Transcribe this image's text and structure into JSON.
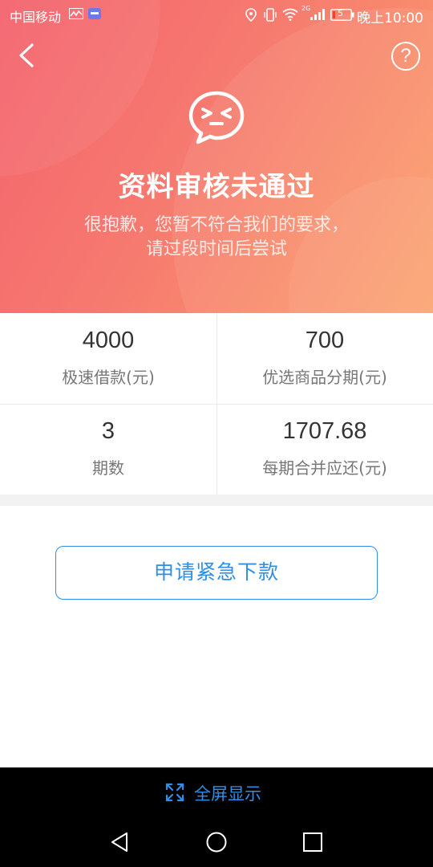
{
  "status_bar": {
    "carrier": "中国移动",
    "battery": "5",
    "network": "2G",
    "time": "晚上10:00"
  },
  "header": {
    "back_icon": "chevron-left-icon",
    "help_icon": "question-circle-icon",
    "help_glyph": "?",
    "status_icon": "dizzy-face-chat-bubble-icon",
    "title": "资料审核未通过",
    "description": "很抱歉，您暂不符合我们的要求，请过段时间后尝试"
  },
  "stats": [
    {
      "value": "4000",
      "label": "极速借款(元)"
    },
    {
      "value": "700",
      "label": "优选商品分期(元)"
    },
    {
      "value": "3",
      "label": "期数"
    },
    {
      "value": "1707.68",
      "label": "每期合并应还(元)"
    }
  ],
  "actions": {
    "apply_label": "申请紧急下款"
  },
  "fullscreen": {
    "label": "全屏显示",
    "icon": "expand-icon"
  },
  "colors": {
    "hero_gradient_start": "#f4636e",
    "hero_gradient_end": "#fba06a",
    "accent_blue": "#2f8fe6",
    "text_dark": "#333333",
    "text_muted": "#777777"
  }
}
